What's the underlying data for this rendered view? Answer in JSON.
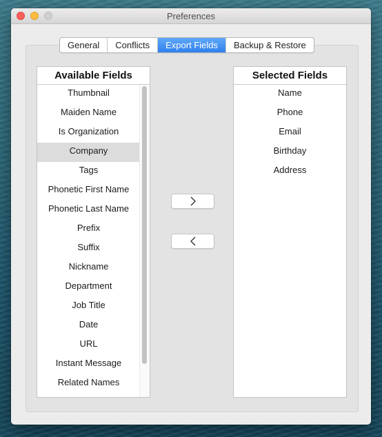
{
  "window": {
    "title": "Preferences"
  },
  "tabs": [
    {
      "label": "General"
    },
    {
      "label": "Conflicts"
    },
    {
      "label": "Export Fields"
    },
    {
      "label": "Backup & Restore"
    }
  ],
  "active_tab": "Export Fields",
  "available_fields": {
    "header": "Available Fields",
    "items": [
      {
        "label": "Thumbnail"
      },
      {
        "label": "Maiden Name"
      },
      {
        "label": "Is Organization"
      },
      {
        "label": "Company"
      },
      {
        "label": "Tags"
      },
      {
        "label": "Phonetic First Name"
      },
      {
        "label": "Phonetic Last Name"
      },
      {
        "label": "Prefix"
      },
      {
        "label": "Suffix"
      },
      {
        "label": "Nickname"
      },
      {
        "label": "Department"
      },
      {
        "label": "Job Title"
      },
      {
        "label": "Date"
      },
      {
        "label": "URL"
      },
      {
        "label": "Instant Message"
      },
      {
        "label": "Related Names"
      }
    ],
    "highlighted_item": "Company"
  },
  "selected_fields": {
    "header": "Selected Fields",
    "items": [
      {
        "label": "Name"
      },
      {
        "label": "Phone"
      },
      {
        "label": "Email"
      },
      {
        "label": "Birthday"
      },
      {
        "label": "Address"
      }
    ]
  },
  "buttons": {
    "add_icon": "chevron-right-icon",
    "remove_icon": "chevron-left-icon"
  },
  "colors": {
    "accent": "#2f80ed",
    "close": "#fc605c",
    "minimize": "#fdbc40",
    "zoom_disabled": "#d0d0d0"
  }
}
